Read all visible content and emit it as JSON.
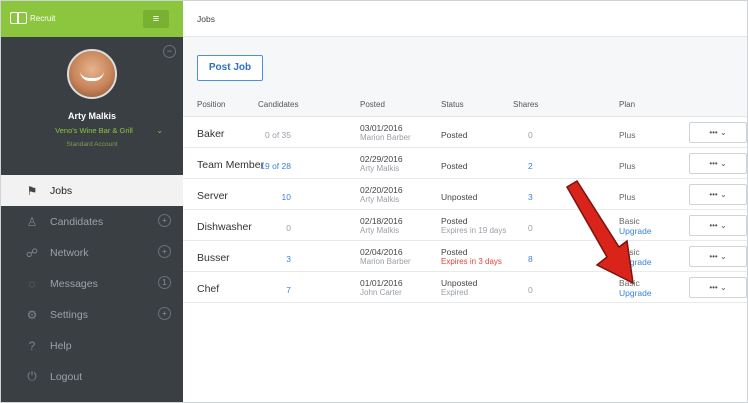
{
  "app": {
    "logo_text": "Recruit",
    "collapse_icon": "≡"
  },
  "profile": {
    "name": "Arty Malkis",
    "business": "Veno's Wine Bar & Grill",
    "account_type": "Standard Account"
  },
  "nav": [
    {
      "label": "Jobs",
      "icon": "⚑",
      "badge": ""
    },
    {
      "label": "Candidates",
      "icon": "♙",
      "badge": "+"
    },
    {
      "label": "Network",
      "icon": "☍",
      "badge": "+"
    },
    {
      "label": "Messages",
      "icon": "◌",
      "badge": "1"
    },
    {
      "label": "Settings",
      "icon": "⚙",
      "badge": "+"
    },
    {
      "label": "Help",
      "icon": "?",
      "badge": ""
    },
    {
      "label": "Logout",
      "icon": "⏻",
      "badge": ""
    }
  ],
  "page": {
    "title": "Jobs",
    "post_job_label": "Post Job"
  },
  "table": {
    "columns": [
      "Position",
      "Candidates",
      "Posted",
      "Status",
      "Shares",
      "Plan"
    ],
    "rows": [
      {
        "position": "Baker",
        "candidates": "0 of 35",
        "posted_date": "03/01/2016",
        "posted_by": "Marion Barber",
        "status": "Posted",
        "status_sub": "",
        "shares": "0",
        "plan": "Plus",
        "plan_link": "",
        "actions": "••• ⌄"
      },
      {
        "position": "Team Member",
        "candidates": "19 of 28",
        "posted_date": "02/29/2016",
        "posted_by": "Arty Malkis",
        "status": "Posted",
        "status_sub": "",
        "shares": "2",
        "plan": "Plus",
        "plan_link": "",
        "actions": "••• ⌄"
      },
      {
        "position": "Server",
        "candidates": "10",
        "posted_date": "02/20/2016",
        "posted_by": "Arty Malkis",
        "status": "Unposted",
        "status_sub": "",
        "shares": "3",
        "plan": "Plus",
        "plan_link": "",
        "actions": "••• ⌄"
      },
      {
        "position": "Dishwasher",
        "candidates": "0",
        "posted_date": "02/18/2016",
        "posted_by": "Arty Malkis",
        "status": "Posted",
        "status_sub": "Expires in 19 days",
        "shares": "0",
        "plan": "Basic",
        "plan_link": "Upgrade",
        "actions": "••• ⌄"
      },
      {
        "position": "Busser",
        "candidates": "3",
        "posted_date": "02/04/2016",
        "posted_by": "Marion Barber",
        "status": "Posted",
        "status_sub": "Expires in 3 days",
        "shares": "8",
        "plan": "Basic",
        "plan_link": "Upgrade",
        "actions": "••• ⌄"
      },
      {
        "position": "Chef",
        "candidates": "7",
        "posted_date": "01/01/2016",
        "posted_by": "John Carter",
        "status": "Unposted",
        "status_sub": "Expired",
        "shares": "0",
        "plan": "Basic",
        "plan_link": "Upgrade",
        "actions": "••• ⌄"
      }
    ]
  },
  "colors": {
    "brand_green": "#8cc63f",
    "sidebar": "#3a3f44",
    "link_blue": "#3b82d6",
    "warning_red": "#e2453b",
    "arrow_red": "#d9231b"
  }
}
